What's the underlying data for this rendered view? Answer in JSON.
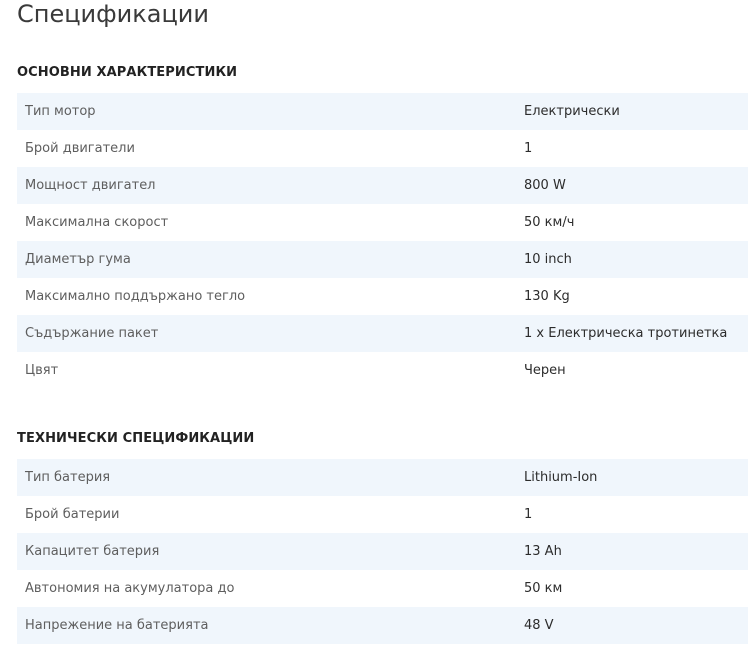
{
  "page": {
    "title": "Спецификации"
  },
  "sections": [
    {
      "title": "ОСНОВНИ ХАРАКТЕРИСТИКИ",
      "rows": [
        {
          "label": "Тип мотор",
          "value": "Електрически"
        },
        {
          "label": "Брой двигатели",
          "value": "1"
        },
        {
          "label": "Мощност двигател",
          "value": "800 W"
        },
        {
          "label": "Максимална скорост",
          "value": "50 км/ч"
        },
        {
          "label": "Диаметър гума",
          "value": "10 inch"
        },
        {
          "label": "Максимално поддържано тегло",
          "value": "130 Kg"
        },
        {
          "label": "Съдържание пакет",
          "value": "1 x Електрическа тротинетка"
        },
        {
          "label": "Цвят",
          "value": "Черен"
        }
      ]
    },
    {
      "title": "ТЕХНИЧЕСКИ СПЕЦИФИКАЦИИ",
      "rows": [
        {
          "label": "Тип батерия",
          "value": "Lithium-Ion"
        },
        {
          "label": "Брой батерии",
          "value": "1"
        },
        {
          "label": "Капацитет батерия",
          "value": "13 Ah"
        },
        {
          "label": "Автономия на акумулатора до",
          "value": "50 км"
        },
        {
          "label": "Напрежение на батерията",
          "value": "48 V"
        }
      ]
    }
  ],
  "colors": {
    "row_stripe": "#f0f6fc",
    "label_text": "#5e5e5e",
    "value_text": "#2c2c2c"
  }
}
